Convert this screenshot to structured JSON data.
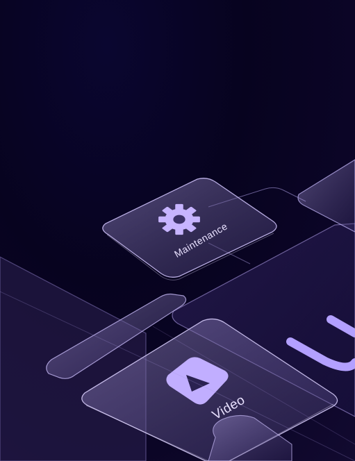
{
  "tiles": [
    {
      "id": "maintenance",
      "label": "Maintenance",
      "icon": "gear-icon"
    },
    {
      "id": "video",
      "label": "Video",
      "icon": "play-icon"
    }
  ],
  "colors": {
    "background": "#07031f",
    "accent": "#b9a4ff",
    "glass": "#cbbcff"
  }
}
